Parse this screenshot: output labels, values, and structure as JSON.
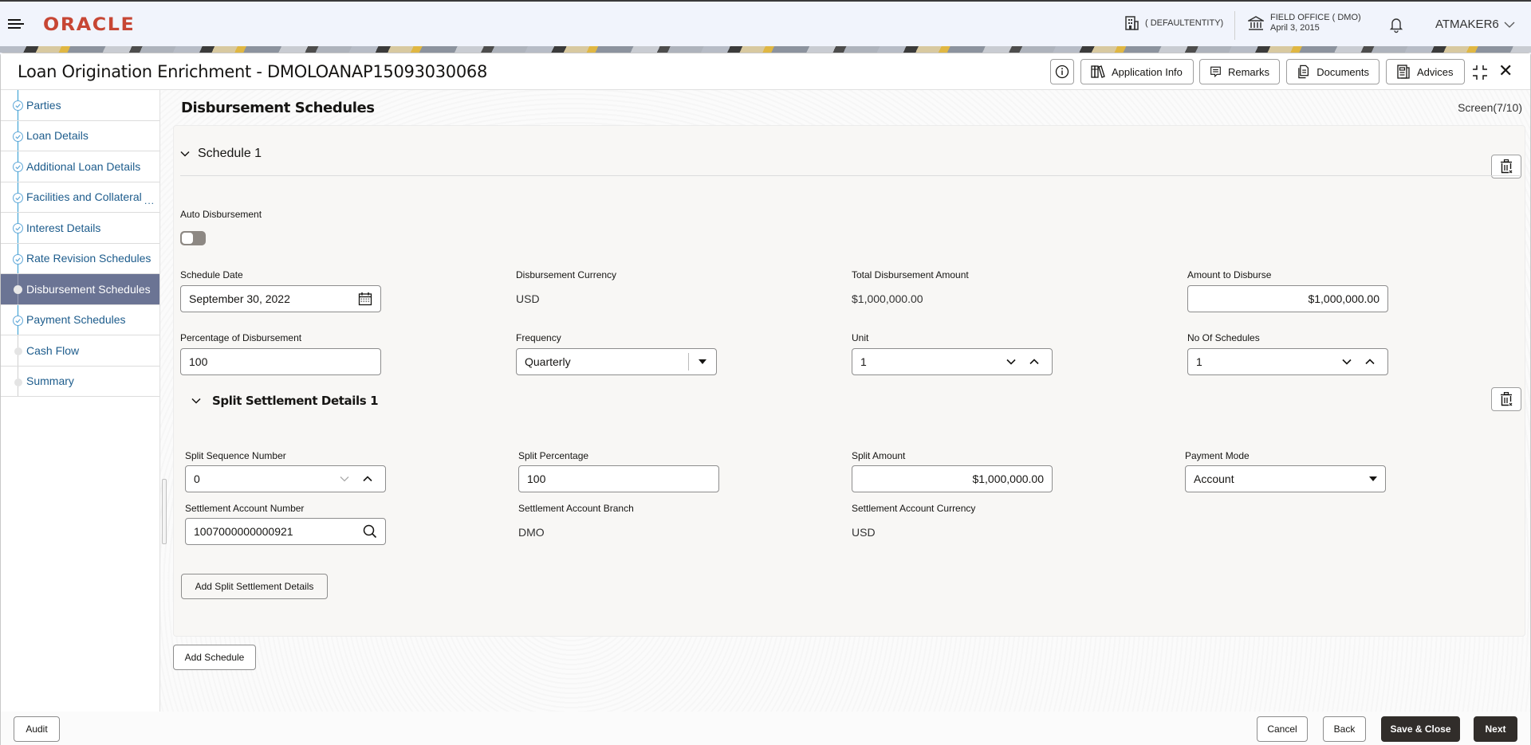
{
  "header": {
    "brand": "ORACLE",
    "entity": "( DEFAULTENTITY)",
    "office_name": "FIELD OFFICE ( DMO)",
    "office_date": "April 3, 2015",
    "user": "ATMAKER6"
  },
  "window": {
    "title": "Loan Origination Enrichment - DMOLOANAP15093030068",
    "toolbar": {
      "application_info": "Application Info",
      "remarks": "Remarks",
      "documents": "Documents",
      "advices": "Advices"
    }
  },
  "sidebar": {
    "items": [
      {
        "label": "Parties",
        "status": "completed"
      },
      {
        "label": "Loan Details",
        "status": "completed"
      },
      {
        "label": "Additional Loan Details",
        "status": "completed"
      },
      {
        "label": "Facilities and Collateral",
        "status": "completed",
        "truncated": true
      },
      {
        "label": "Interest Details",
        "status": "completed"
      },
      {
        "label": "Rate Revision Schedules",
        "status": "completed"
      },
      {
        "label": "Disbursement Schedules",
        "status": "active"
      },
      {
        "label": "Payment Schedules",
        "status": "completed"
      },
      {
        "label": "Cash Flow",
        "status": "pending"
      },
      {
        "label": "Summary",
        "status": "pending"
      }
    ],
    "ellipsis": "..."
  },
  "main": {
    "section_title": "Disbursement Schedules",
    "screen_indicator": "Screen(7/10)",
    "schedule": {
      "title": "Schedule 1",
      "auto_disbursement_label": "Auto Disbursement",
      "auto_disbursement_on": false,
      "schedule_date_label": "Schedule Date",
      "schedule_date": "September 30, 2022",
      "currency_label": "Disbursement Currency",
      "currency": "USD",
      "total_label": "Total Disbursement Amount",
      "total": "$1,000,000.00",
      "amount_label": "Amount to Disburse",
      "amount": "$1,000,000.00",
      "percentage_label": "Percentage of Disbursement",
      "percentage": "100",
      "frequency_label": "Frequency",
      "frequency": "Quarterly",
      "unit_label": "Unit",
      "unit": "1",
      "no_schedules_label": "No Of Schedules",
      "no_schedules": "1"
    },
    "split": {
      "title": "Split Settlement Details 1",
      "seq_label": "Split Sequence Number",
      "seq": "0",
      "pct_label": "Split Percentage",
      "pct": "100",
      "amount_label": "Split Amount",
      "amount": "$1,000,000.00",
      "mode_label": "Payment Mode",
      "mode": "Account",
      "acct_label": "Settlement Account Number",
      "acct": "1007000000000921",
      "branch_label": "Settlement Account Branch",
      "branch": "DMO",
      "acct_currency_label": "Settlement Account Currency",
      "acct_currency": "USD"
    },
    "add_split_button": "Add Split Settlement Details",
    "add_schedule_button": "Add Schedule"
  },
  "footer": {
    "audit": "Audit",
    "cancel": "Cancel",
    "back": "Back",
    "save_close": "Save & Close",
    "next": "Next"
  }
}
